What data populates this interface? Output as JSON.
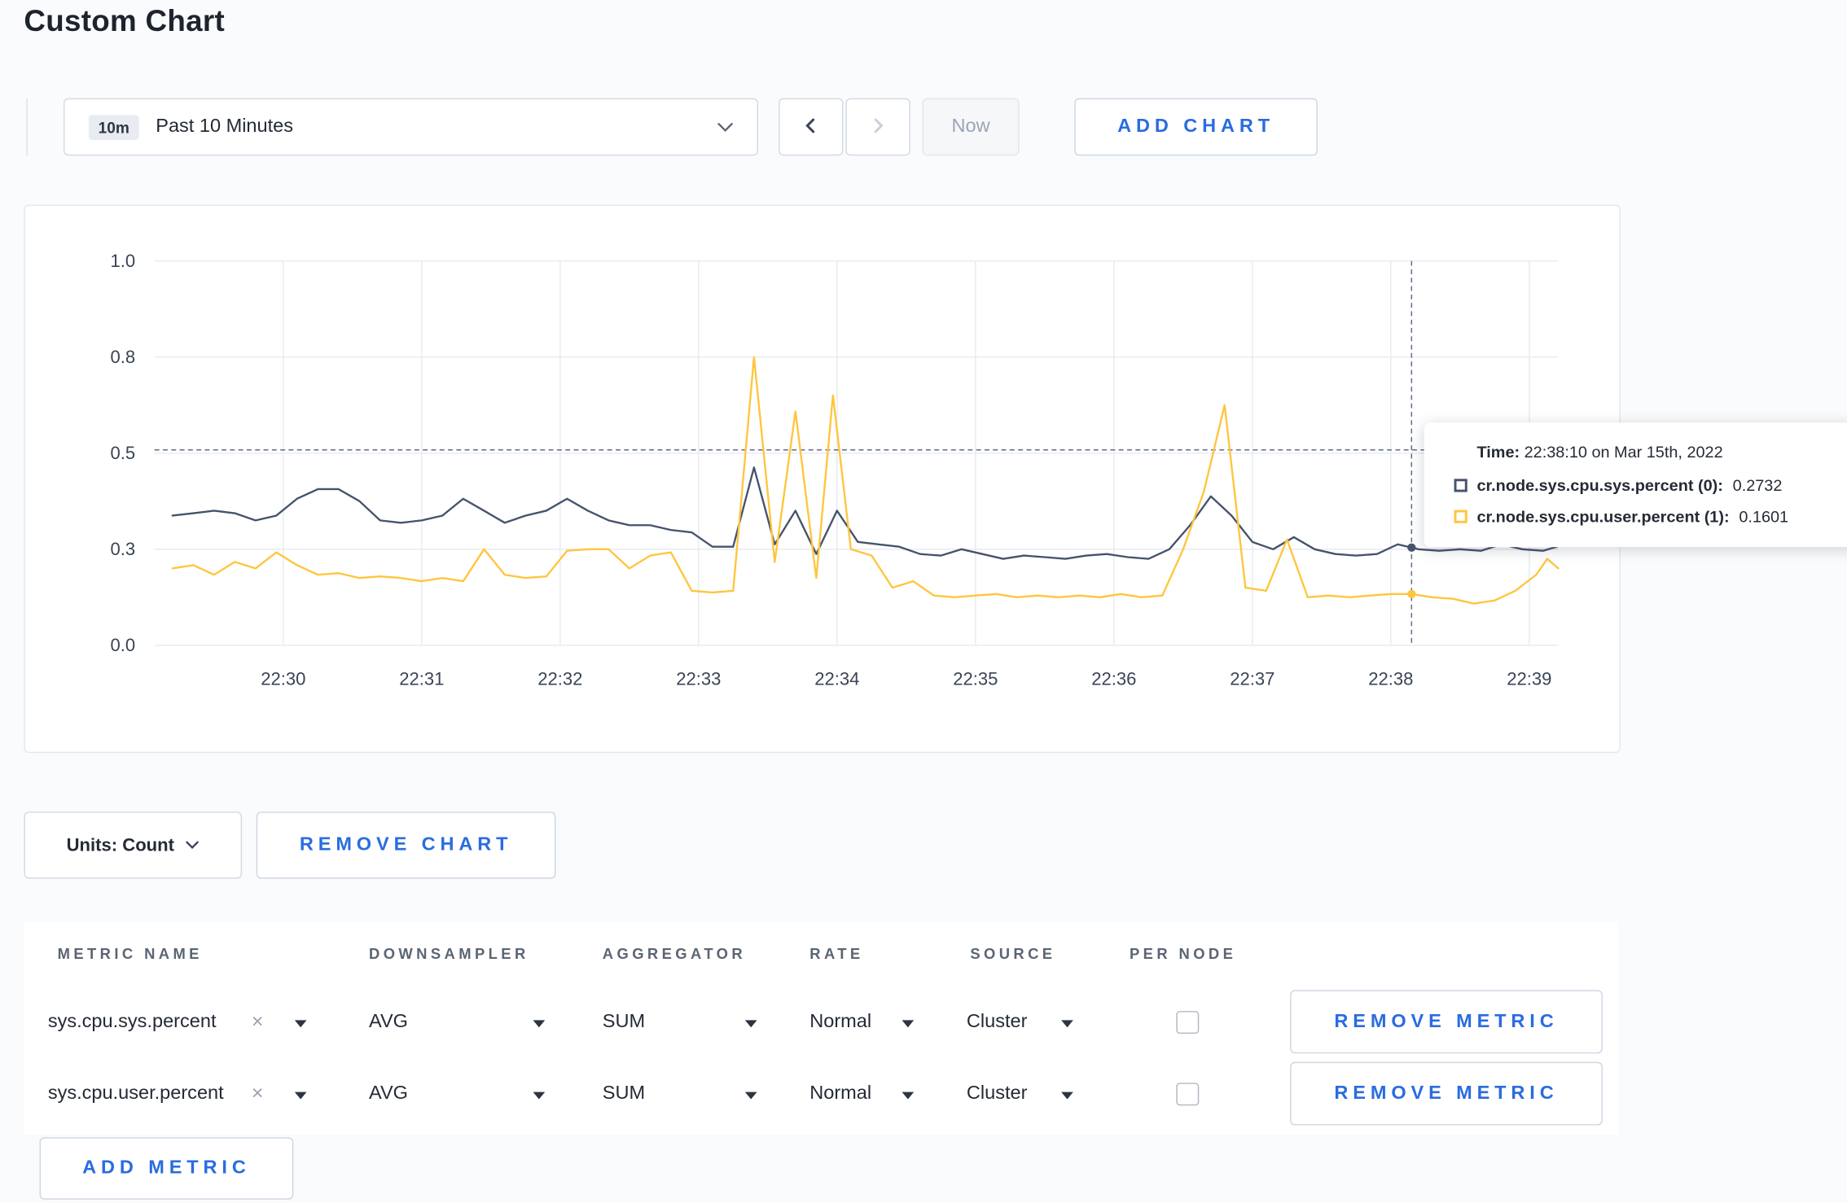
{
  "page": {
    "title": "Custom Chart"
  },
  "icons": {
    "clear": "×"
  },
  "toolbar": {
    "time_range_badge": "10m",
    "time_range_label": "Past 10 Minutes",
    "now_label": "Now",
    "add_chart_label": "ADD CHART"
  },
  "chart_controls": {
    "units_label": "Units: Count",
    "remove_chart_label": "REMOVE CHART"
  },
  "tooltip": {
    "time_label": "Time:",
    "time_value": "22:38:10 on Mar 15th, 2022",
    "series": [
      {
        "label": "cr.node.sys.cpu.sys.percent (0):",
        "value": "0.2732"
      },
      {
        "label": "cr.node.sys.cpu.user.percent (1):",
        "value": "0.1601"
      }
    ]
  },
  "metrics_table": {
    "headers": [
      "METRIC NAME",
      "DOWNSAMPLER",
      "AGGREGATOR",
      "RATE",
      "SOURCE",
      "PER NODE"
    ],
    "rows": [
      {
        "metric": "sys.cpu.sys.percent",
        "downsampler": "AVG",
        "aggregator": "SUM",
        "rate": "Normal",
        "source": "Cluster",
        "per_node_checked": false,
        "remove_label": "REMOVE METRIC"
      },
      {
        "metric": "sys.cpu.user.percent",
        "downsampler": "AVG",
        "aggregator": "SUM",
        "rate": "Normal",
        "source": "Cluster",
        "per_node_checked": false,
        "remove_label": "REMOVE METRIC"
      }
    ],
    "add_metric_label": "ADD METRIC"
  },
  "chart_data": {
    "type": "line",
    "title": "",
    "xlabel": "",
    "ylabel": "",
    "x_min": 29.07,
    "x_max": 39.21,
    "x_tick_values": [
      30,
      31,
      32,
      33,
      34,
      35,
      36,
      37,
      38,
      39
    ],
    "x_tick_labels": [
      "22:30",
      "22:31",
      "22:32",
      "22:33",
      "22:34",
      "22:35",
      "22:36",
      "22:37",
      "22:38",
      "22:39"
    ],
    "y_tick_values": [
      0.0,
      0.3,
      0.5,
      0.8,
      1.0
    ],
    "y_tick_labels": [
      "0.0",
      "0.3",
      "0.5",
      "0.8",
      "1.0"
    ],
    "y_scale": "even-ticks",
    "grid": true,
    "hline_value": 0.51,
    "crosshair_time": 38.15,
    "series": [
      {
        "name": "cr.node.sys.cpu.sys.percent",
        "color": "#46536b",
        "crosshair_value": 0.2732,
        "points": [
          [
            29.2,
            0.37
          ],
          [
            29.35,
            0.375
          ],
          [
            29.5,
            0.38
          ],
          [
            29.65,
            0.375
          ],
          [
            29.8,
            0.36
          ],
          [
            29.95,
            0.37
          ],
          [
            30.1,
            0.405
          ],
          [
            30.25,
            0.425
          ],
          [
            30.4,
            0.425
          ],
          [
            30.55,
            0.4
          ],
          [
            30.7,
            0.36
          ],
          [
            30.85,
            0.355
          ],
          [
            31.0,
            0.36
          ],
          [
            31.15,
            0.37
          ],
          [
            31.3,
            0.405
          ],
          [
            31.45,
            0.38
          ],
          [
            31.6,
            0.355
          ],
          [
            31.75,
            0.37
          ],
          [
            31.9,
            0.38
          ],
          [
            32.05,
            0.405
          ],
          [
            32.2,
            0.38
          ],
          [
            32.35,
            0.36
          ],
          [
            32.5,
            0.35
          ],
          [
            32.65,
            0.35
          ],
          [
            32.8,
            0.34
          ],
          [
            32.95,
            0.335
          ],
          [
            33.1,
            0.305
          ],
          [
            33.25,
            0.305
          ],
          [
            33.4,
            0.47
          ],
          [
            33.55,
            0.31
          ],
          [
            33.7,
            0.38
          ],
          [
            33.85,
            0.285
          ],
          [
            34.0,
            0.38
          ],
          [
            34.15,
            0.315
          ],
          [
            34.3,
            0.31
          ],
          [
            34.45,
            0.305
          ],
          [
            34.6,
            0.285
          ],
          [
            34.75,
            0.28
          ],
          [
            34.9,
            0.3
          ],
          [
            35.05,
            0.285
          ],
          [
            35.2,
            0.27
          ],
          [
            35.35,
            0.28
          ],
          [
            35.5,
            0.275
          ],
          [
            35.65,
            0.27
          ],
          [
            35.8,
            0.28
          ],
          [
            35.95,
            0.285
          ],
          [
            36.1,
            0.275
          ],
          [
            36.25,
            0.27
          ],
          [
            36.4,
            0.3
          ],
          [
            36.55,
            0.35
          ],
          [
            36.7,
            0.41
          ],
          [
            36.85,
            0.37
          ],
          [
            37.0,
            0.315
          ],
          [
            37.15,
            0.3
          ],
          [
            37.3,
            0.325
          ],
          [
            37.45,
            0.3
          ],
          [
            37.6,
            0.285
          ],
          [
            37.75,
            0.28
          ],
          [
            37.9,
            0.285
          ],
          [
            38.05,
            0.31
          ],
          [
            38.2,
            0.3
          ],
          [
            38.35,
            0.295
          ],
          [
            38.5,
            0.3
          ],
          [
            38.65,
            0.295
          ],
          [
            38.8,
            0.31
          ],
          [
            38.95,
            0.3
          ],
          [
            39.1,
            0.295
          ],
          [
            39.2,
            0.305
          ]
        ]
      },
      {
        "name": "cr.node.sys.cpu.user.percent",
        "color": "#ffc53d",
        "crosshair_value": 0.1601,
        "points": [
          [
            29.2,
            0.24
          ],
          [
            29.35,
            0.25
          ],
          [
            29.5,
            0.22
          ],
          [
            29.65,
            0.26
          ],
          [
            29.8,
            0.24
          ],
          [
            29.95,
            0.29
          ],
          [
            30.1,
            0.25
          ],
          [
            30.25,
            0.22
          ],
          [
            30.4,
            0.225
          ],
          [
            30.55,
            0.21
          ],
          [
            30.7,
            0.215
          ],
          [
            30.85,
            0.21
          ],
          [
            31.0,
            0.2
          ],
          [
            31.15,
            0.21
          ],
          [
            31.3,
            0.2
          ],
          [
            31.45,
            0.3
          ],
          [
            31.6,
            0.22
          ],
          [
            31.75,
            0.21
          ],
          [
            31.9,
            0.215
          ],
          [
            32.05,
            0.295
          ],
          [
            32.2,
            0.3
          ],
          [
            32.35,
            0.3
          ],
          [
            32.5,
            0.24
          ],
          [
            32.65,
            0.28
          ],
          [
            32.8,
            0.29
          ],
          [
            32.95,
            0.17
          ],
          [
            33.1,
            0.165
          ],
          [
            33.25,
            0.17
          ],
          [
            33.4,
            0.8
          ],
          [
            33.55,
            0.26
          ],
          [
            33.7,
            0.63
          ],
          [
            33.85,
            0.21
          ],
          [
            33.97,
            0.68
          ],
          [
            34.1,
            0.3
          ],
          [
            34.25,
            0.28
          ],
          [
            34.4,
            0.18
          ],
          [
            34.55,
            0.2
          ],
          [
            34.7,
            0.155
          ],
          [
            34.85,
            0.15
          ],
          [
            35.0,
            0.155
          ],
          [
            35.15,
            0.16
          ],
          [
            35.3,
            0.15
          ],
          [
            35.45,
            0.155
          ],
          [
            35.6,
            0.15
          ],
          [
            35.75,
            0.155
          ],
          [
            35.9,
            0.15
          ],
          [
            36.05,
            0.16
          ],
          [
            36.2,
            0.15
          ],
          [
            36.35,
            0.155
          ],
          [
            36.5,
            0.3
          ],
          [
            36.65,
            0.42
          ],
          [
            36.8,
            0.65
          ],
          [
            36.95,
            0.18
          ],
          [
            37.1,
            0.17
          ],
          [
            37.25,
            0.32
          ],
          [
            37.4,
            0.15
          ],
          [
            37.55,
            0.155
          ],
          [
            37.7,
            0.15
          ],
          [
            37.85,
            0.155
          ],
          [
            38.0,
            0.16
          ],
          [
            38.15,
            0.16
          ],
          [
            38.3,
            0.15
          ],
          [
            38.45,
            0.145
          ],
          [
            38.6,
            0.13
          ],
          [
            38.75,
            0.14
          ],
          [
            38.9,
            0.17
          ],
          [
            39.05,
            0.22
          ],
          [
            39.13,
            0.27
          ],
          [
            39.21,
            0.24
          ]
        ]
      }
    ]
  }
}
